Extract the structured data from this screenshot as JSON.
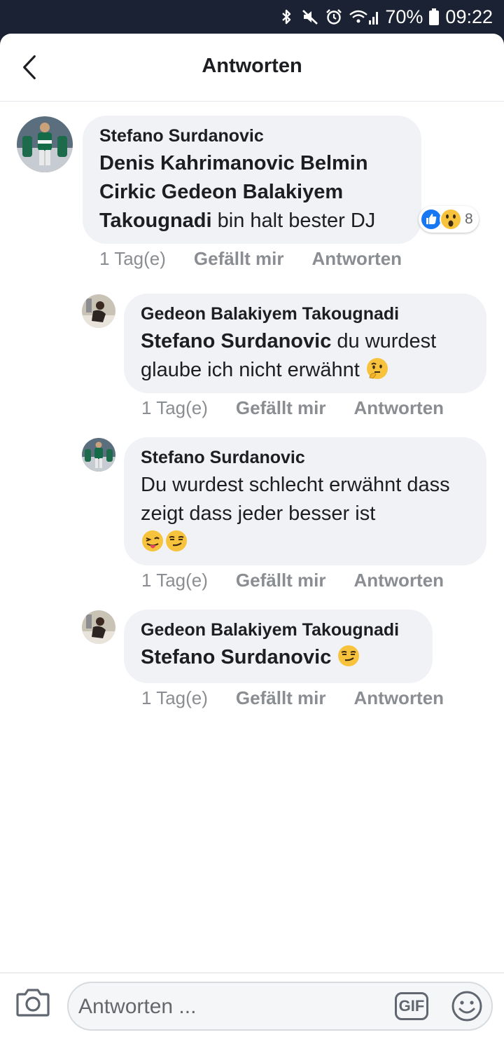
{
  "status_bar": {
    "battery": "70%",
    "time": "09:22"
  },
  "header": {
    "title": "Antworten"
  },
  "comments": [
    {
      "author": "Stefano Surdanovic",
      "mention": "Denis Kahrimanovic Belmin Cirkic Gedeon Balakiyem Takougnadi",
      "text": " bin halt bester DJ",
      "time": "1 Tag(e)",
      "like_label": "Gefällt mir",
      "reply_label": "Antworten",
      "reaction_count": "8",
      "reactions": [
        "like-icon",
        "wow-icon"
      ]
    },
    {
      "author": "Gedeon Balakiyem Takougnadi",
      "mention": "Stefano Surdanovic",
      "text": " du wurdest glaube ich nicht erwähnt",
      "emoji": [
        "thinking-face-icon"
      ],
      "time": "1 Tag(e)",
      "like_label": "Gefällt mir",
      "reply_label": "Antworten"
    },
    {
      "author": "Stefano Surdanovic",
      "text": "Du wurdest schlecht erwähnt dass zeigt dass jeder besser ist",
      "emoji": [
        "tongue-wink-icon",
        "smirk-icon"
      ],
      "time": "1 Tag(e)",
      "like_label": "Gefällt mir",
      "reply_label": "Antworten"
    },
    {
      "author": "Gedeon Balakiyem Takougnadi",
      "mention": "Stefano Surdanovic",
      "emoji": [
        "smirk-icon"
      ],
      "time": "1 Tag(e)",
      "like_label": "Gefällt mir",
      "reply_label": "Antworten"
    }
  ],
  "compose": {
    "placeholder": "Antworten ...",
    "gif_label": "GIF"
  },
  "colors": {
    "bubble": "#f0f2f5",
    "muted": "#8a8d91",
    "like_blue": "#1877f2",
    "emoji_yellow": "#f7c33d"
  }
}
